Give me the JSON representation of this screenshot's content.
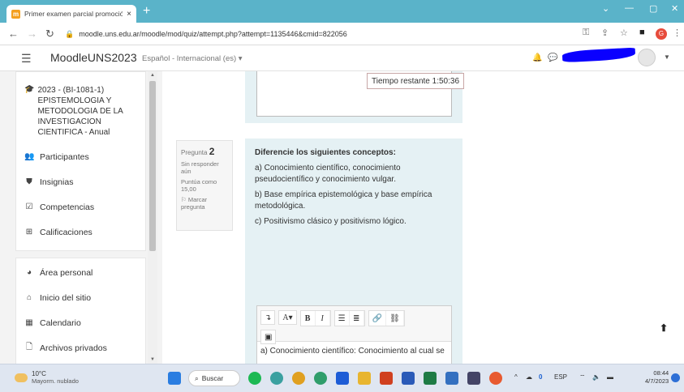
{
  "browser": {
    "tab_title": "Primer examen parcial promoció",
    "tab_close": "×",
    "new_tab": "+",
    "window_minimize": "—",
    "window_maximize": "▢",
    "window_close": "✕",
    "window_chevron": "⌄",
    "url": "moodle.uns.edu.ar/moodle/mod/quiz/attempt.php?attempt=1135446&cmid=822056"
  },
  "navbar": {
    "brand": "MoodleUNS2023",
    "language": "Español - Internacional (es) ▾"
  },
  "drawer": {
    "course_title": "2023 - (BI-1081-1) EPISTEMOLOGIA Y METODOLOGIA DE LA INVESTIGACION CIENTIFICA - Anual",
    "course_items": [
      {
        "label": "Participantes",
        "icon": "users-icon"
      },
      {
        "label": "Insignias",
        "icon": "shield-icon"
      },
      {
        "label": "Competencias",
        "icon": "checkbox-icon"
      },
      {
        "label": "Calificaciones",
        "icon": "table-icon"
      }
    ],
    "site_items": [
      {
        "label": "Área personal",
        "icon": "dashboard-icon"
      },
      {
        "label": "Inicio del sitio",
        "icon": "home-icon"
      },
      {
        "label": "Calendario",
        "icon": "calendar-icon"
      },
      {
        "label": "Archivos privados",
        "icon": "file-icon"
      }
    ]
  },
  "quiz": {
    "timer": "Tiempo restante 1:50:36",
    "question_label": "Pregunta",
    "question_number": "2",
    "status": "Sin responder aún",
    "score": "Puntúa como 15,00",
    "flag": "Marcar pregunta",
    "prompt_heading": "Diferencie los siguientes conceptos:",
    "prompt_items": [
      "a) Conocimiento científico, conocimiento pseudocientífico y conocimiento vulgar.",
      "b) Base empírica epistemológica y base empírica metodológica.",
      "c) Positivismo clásico y positivismo lógico."
    ],
    "answer_text": "a) Conocimiento científico: Conocimiento al cual se"
  },
  "taskbar": {
    "temp": "10°C",
    "weather": "Mayorm. nublado",
    "search": "Buscar",
    "lang": "ESP",
    "time": "08:44",
    "date": "4/7/2023"
  }
}
